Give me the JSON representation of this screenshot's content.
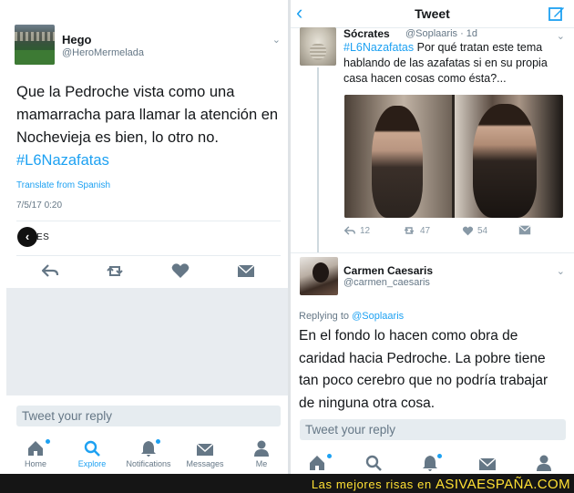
{
  "left": {
    "tweet": {
      "name": "Hego",
      "handle": "@HeroMermelada",
      "text_before": "Que la Pedroche vista como una mamarracha para llamar la atención en Nochevieja es bien, lo otro no.",
      "hashtag": "#L6Nazafatas",
      "translate": "Translate from Spanish",
      "date": "7/5/17 0:20",
      "likes_label": "ES"
    },
    "reply_placeholder": "Tweet your reply",
    "tabs": [
      {
        "label": "Home",
        "icon": "home-icon"
      },
      {
        "label": "Explore",
        "icon": "search-icon"
      },
      {
        "label": "Notifications",
        "icon": "bell-icon"
      },
      {
        "label": "Messages",
        "icon": "envelope-icon"
      },
      {
        "label": "Me",
        "icon": "person-icon"
      }
    ]
  },
  "right": {
    "nav_title": "Tweet",
    "tweet": {
      "name": "Sócrates",
      "handle": "@Soplaaris · 1d",
      "hashtag": "#L6Nazafatas",
      "text": "Por qué tratan este tema hablando de las azafatas si en su propia casa hacen cosas como ésta?...",
      "replies": "12",
      "retweets": "47",
      "likes": "54"
    },
    "reply_tweet": {
      "name": "Carmen Caesaris",
      "handle": "@carmen_caesaris",
      "replying_prefix": "Replying to",
      "replying_to": "@Soplaaris",
      "text": "En el fondo lo hacen como obra de caridad hacia Pedroche. La pobre tiene tan poco cerebro que no podría trabajar de ninguna otra cosa."
    },
    "reply_placeholder": "Tweet your reply"
  },
  "banner": {
    "prefix": "Las mejores risas en",
    "brand": "ASIVAESPAÑA.COM"
  },
  "colors": {
    "accent": "#1da1f2",
    "icon_gray": "#657786",
    "banner_bg": "#151515",
    "banner_text": "#ffe033"
  }
}
